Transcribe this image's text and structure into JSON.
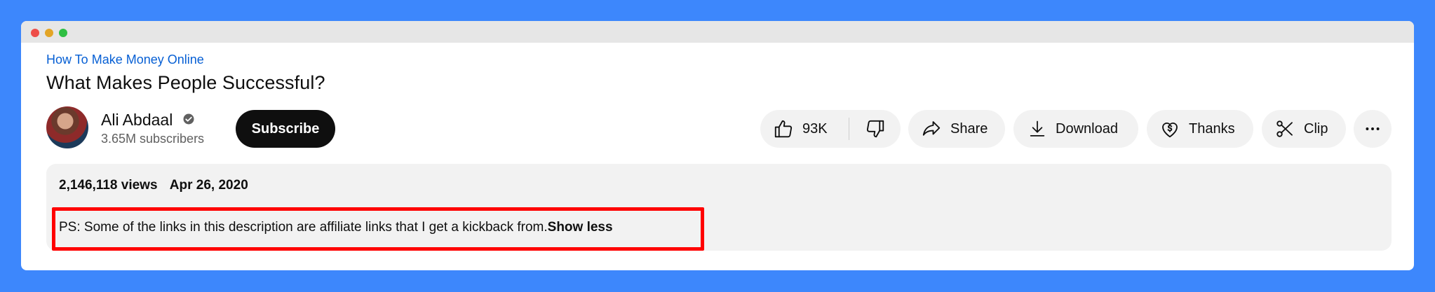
{
  "video": {
    "hashtag": "How To Make Money Online",
    "title": "What Makes People Successful?"
  },
  "channel": {
    "name": "Ali Abdaal",
    "subscribers": "3.65M subscribers",
    "verified_icon": "verified-check-icon",
    "subscribe_label": "Subscribe"
  },
  "actions": {
    "like_count": "93K",
    "share_label": "Share",
    "download_label": "Download",
    "thanks_label": "Thanks",
    "clip_label": "Clip"
  },
  "description": {
    "views": "2,146,118 views",
    "date": "Apr 26, 2020",
    "text": "PS: Some of the links in this description are affiliate links that I get a kickback from.",
    "show_less": "Show less"
  },
  "colors": {
    "background": "#3d87fc",
    "link": "#065fd4",
    "highlight": "#ff0000",
    "subscribe_bg": "#0f0f0f"
  }
}
